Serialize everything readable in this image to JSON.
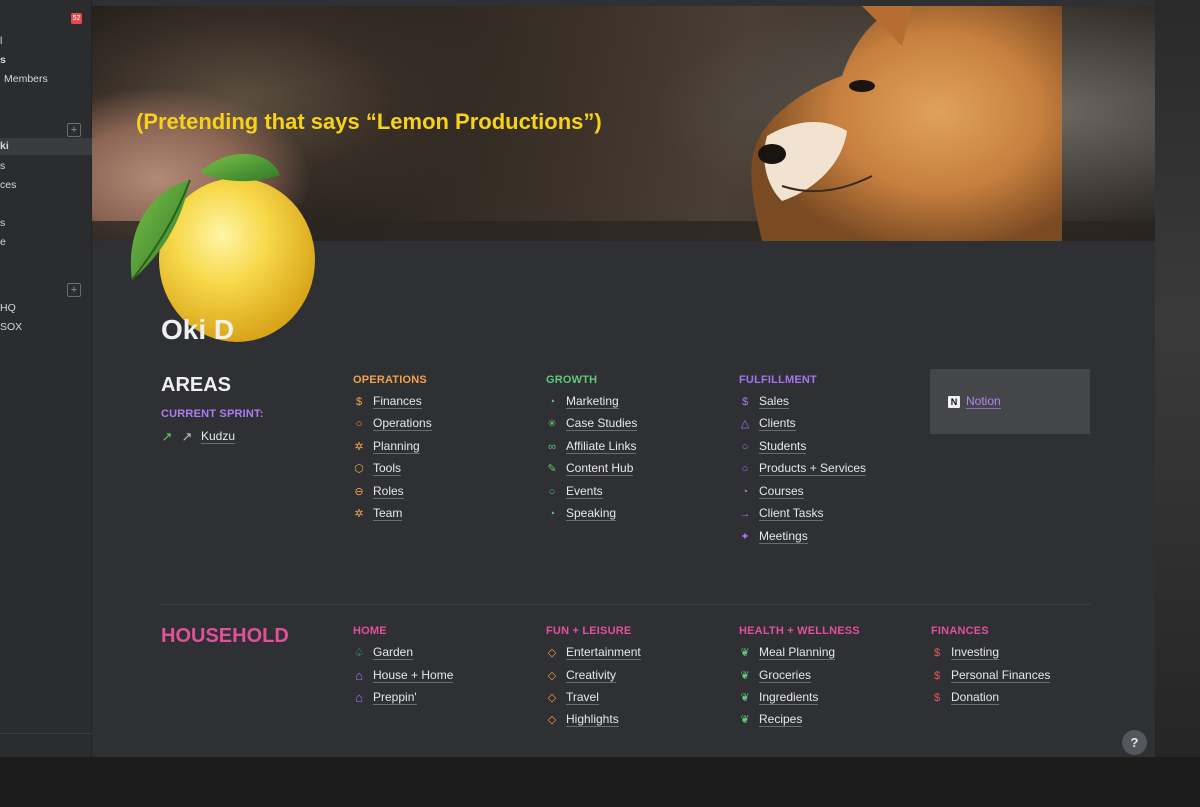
{
  "sidebar": {
    "badge": "52",
    "items": [
      {
        "label": "l"
      },
      {
        "label": "s"
      },
      {
        "label": "Members"
      },
      {
        "label": "ki"
      },
      {
        "label": "s"
      },
      {
        "label": "ces"
      },
      {
        "label": "s"
      },
      {
        "label": "e"
      },
      {
        "label": "HQ"
      },
      {
        "label": "SOX"
      }
    ],
    "plus_symbol": "+"
  },
  "cover": {
    "overlay_text": "(Pretending that says “Lemon Productions”)"
  },
  "page": {
    "title": "Oki D"
  },
  "areas": {
    "title": "AREAS",
    "current_sprint_label": "CURRENT SPRINT:",
    "sprint_link": "Kudzu",
    "columns": [
      {
        "heading": "OPERATIONS",
        "color": "#f1a34b",
        "links": [
          {
            "icon": "dollar-icon",
            "glyph": "$",
            "label": "Finances"
          },
          {
            "icon": "drop-icon",
            "glyph": "○",
            "label": "Operations"
          },
          {
            "icon": "sun-icon",
            "glyph": "✲",
            "label": "Planning"
          },
          {
            "icon": "hexagon-icon",
            "glyph": "⬡",
            "label": "Tools"
          },
          {
            "icon": "circle-half-icon",
            "glyph": "⊖",
            "label": "Roles"
          },
          {
            "icon": "sun-icon",
            "glyph": "✲",
            "label": "Team"
          }
        ]
      },
      {
        "heading": "GROWTH",
        "color": "#5fc87a",
        "links": [
          {
            "icon": "flame-icon",
            "glyph": "◔",
            "label": "Marketing"
          },
          {
            "icon": "burst-icon",
            "glyph": "✳",
            "label": "Case Studies"
          },
          {
            "icon": "link-icon",
            "glyph": "∞",
            "label": "Affiliate Links"
          },
          {
            "icon": "pencil-icon",
            "glyph": "✎",
            "label": "Content Hub"
          },
          {
            "icon": "circle-icon",
            "glyph": "○",
            "label": "Events"
          },
          {
            "icon": "flame-icon",
            "glyph": "◔",
            "label": "Speaking"
          }
        ]
      },
      {
        "heading": "FULFILLMENT",
        "color": "#a774f0",
        "links": [
          {
            "icon": "dollar-icon",
            "glyph": "$",
            "label": "Sales"
          },
          {
            "icon": "triangle-icon",
            "glyph": "△",
            "label": "Clients"
          },
          {
            "icon": "circle-icon",
            "glyph": "○",
            "label": "Students"
          },
          {
            "icon": "circle-icon",
            "glyph": "○",
            "label": "Products + Services"
          },
          {
            "icon": "flame-icon",
            "glyph": "◔",
            "label": "Courses"
          },
          {
            "icon": "arrow-right-icon",
            "glyph": "→",
            "label": "Client Tasks"
          },
          {
            "icon": "sparkle-icon",
            "glyph": "✦",
            "label": "Meetings"
          }
        ]
      }
    ],
    "notion_link": "Notion"
  },
  "household": {
    "title": "HOUSEHOLD",
    "color": "#e0519a",
    "columns": [
      {
        "heading": "HOME",
        "color": "#e0519a",
        "links": [
          {
            "icon": "tree-icon",
            "glyph": "♤",
            "label": "Garden",
            "icon_color": "#5fc87a"
          },
          {
            "icon": "house-icon",
            "glyph": "⌂",
            "label": "House + Home",
            "icon_color": "#a774f0"
          },
          {
            "icon": "house-icon",
            "glyph": "⌂",
            "label": "Preppin'",
            "icon_color": "#a774f0"
          }
        ]
      },
      {
        "heading": "FUN + LEISURE",
        "color": "#e0519a",
        "links": [
          {
            "icon": "diamond-icon",
            "glyph": "◇",
            "label": "Entertainment",
            "icon_color": "#f1a34b"
          },
          {
            "icon": "diamond-icon",
            "glyph": "◇",
            "label": "Creativity",
            "icon_color": "#f1a34b"
          },
          {
            "icon": "diamond-icon",
            "glyph": "◇",
            "label": "Travel",
            "icon_color": "#f1a34b"
          },
          {
            "icon": "diamond-icon",
            "glyph": "◇",
            "label": "Highlights",
            "icon_color": "#f1a34b"
          }
        ]
      },
      {
        "heading": "HEALTH + WELLNESS",
        "color": "#e0519a",
        "links": [
          {
            "icon": "leaf-icon",
            "glyph": "❦",
            "label": "Meal Planning",
            "icon_color": "#5fc87a"
          },
          {
            "icon": "leaf-icon",
            "glyph": "❦",
            "label": "Groceries",
            "icon_color": "#5fc87a"
          },
          {
            "icon": "leaf-icon",
            "glyph": "❦",
            "label": "Ingredients",
            "icon_color": "#5fc87a"
          },
          {
            "icon": "leaf-icon",
            "glyph": "❦",
            "label": "Recipes",
            "icon_color": "#5fc87a"
          }
        ]
      },
      {
        "heading": "FINANCES",
        "color": "#e0519a",
        "links": [
          {
            "icon": "dollar-icon",
            "glyph": "$",
            "label": "Investing",
            "icon_color": "#e55a5a"
          },
          {
            "icon": "dollar-icon",
            "glyph": "$",
            "label": "Personal Finances",
            "icon_color": "#e55a5a"
          },
          {
            "icon": "dollar-icon",
            "glyph": "$",
            "label": "Donation",
            "icon_color": "#e55a5a"
          }
        ]
      }
    ]
  },
  "help": {
    "label": "?"
  }
}
